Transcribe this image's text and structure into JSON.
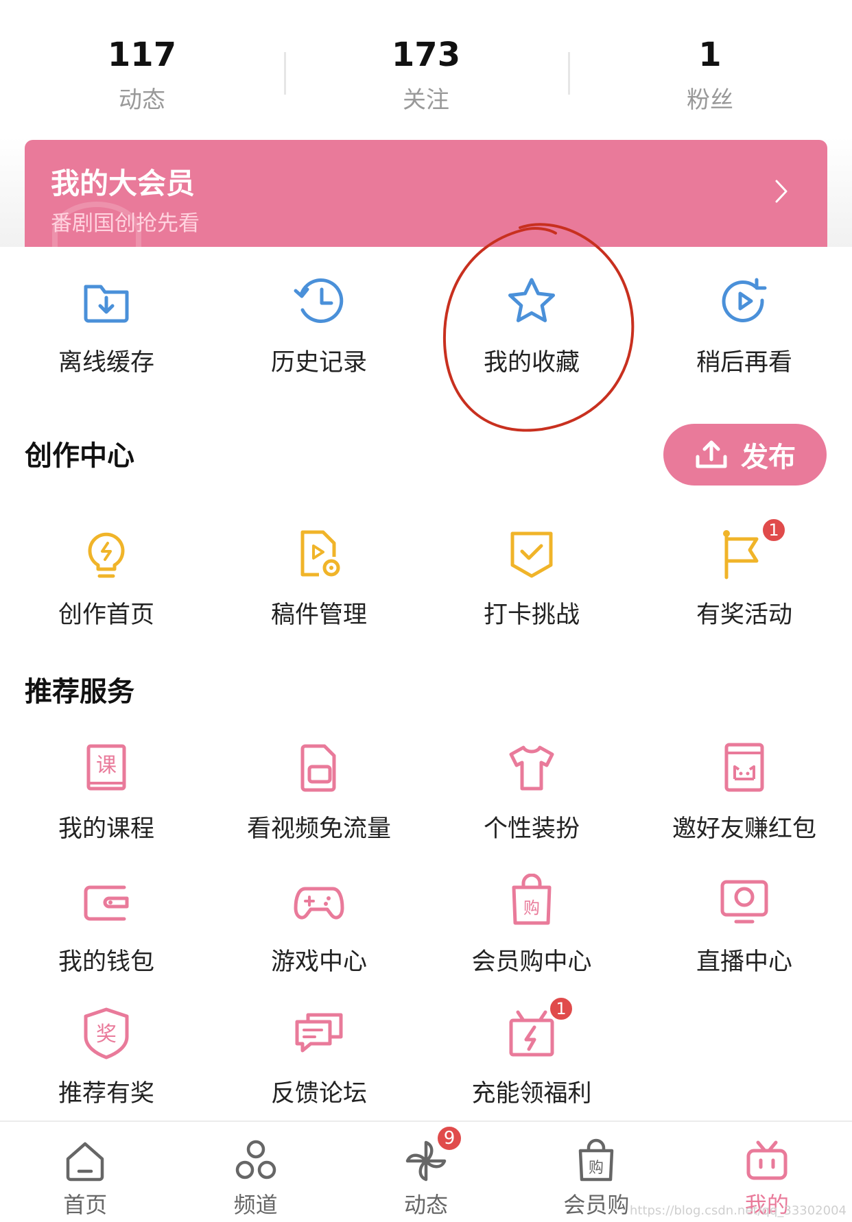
{
  "stats": [
    {
      "value": "117",
      "label": "动态"
    },
    {
      "value": "173",
      "label": "关注"
    },
    {
      "value": "1",
      "label": "粉丝"
    }
  ],
  "vip": {
    "title": "我的大会员",
    "subtitle": "番剧国创抢先看"
  },
  "quick": [
    {
      "label": "离线缓存",
      "icon": "download-folder-icon"
    },
    {
      "label": "历史记录",
      "icon": "history-clock-icon"
    },
    {
      "label": "我的收藏",
      "icon": "star-icon"
    },
    {
      "label": "稍后再看",
      "icon": "watch-later-icon"
    }
  ],
  "creation": {
    "title": "创作中心",
    "publish": "发布",
    "items": [
      {
        "label": "创作首页",
        "icon": "lightbulb-icon"
      },
      {
        "label": "稿件管理",
        "icon": "manuscript-icon"
      },
      {
        "label": "打卡挑战",
        "icon": "checkin-shield-icon"
      },
      {
        "label": "有奖活动",
        "icon": "flag-icon",
        "badge": "1"
      }
    ]
  },
  "services": {
    "title": "推荐服务",
    "rows": [
      [
        {
          "label": "我的课程",
          "icon": "course-book-icon"
        },
        {
          "label": "看视频免流量",
          "icon": "sim-card-icon"
        },
        {
          "label": "个性装扮",
          "icon": "tshirt-icon"
        },
        {
          "label": "邀好友赚红包",
          "icon": "red-envelope-icon"
        }
      ],
      [
        {
          "label": "我的钱包",
          "icon": "wallet-icon"
        },
        {
          "label": "游戏中心",
          "icon": "gamepad-icon"
        },
        {
          "label": "会员购中心",
          "icon": "shopping-bag-icon"
        },
        {
          "label": "直播中心",
          "icon": "live-tv-icon"
        }
      ],
      [
        {
          "label": "推荐有奖",
          "icon": "reward-badge-icon"
        },
        {
          "label": "反馈论坛",
          "icon": "chat-bubbles-icon"
        },
        {
          "label": "充能领福利",
          "icon": "gift-bolt-icon",
          "badge": "1"
        }
      ]
    ]
  },
  "tabs": [
    {
      "label": "首页",
      "icon": "home-icon"
    },
    {
      "label": "频道",
      "icon": "channel-icon"
    },
    {
      "label": "动态",
      "icon": "pinwheel-icon",
      "badge": "9"
    },
    {
      "label": "会员购",
      "icon": "shopping-bag-icon"
    },
    {
      "label": "我的",
      "icon": "tv-mascot-icon",
      "active": true
    }
  ],
  "watermark": "https://blog.csdn.net/qq_33302004",
  "colors": {
    "pink": "#e97a9a",
    "blue": "#4a90d9",
    "yellow": "#f0b429",
    "badge": "#e04b4b",
    "annotation": "#c8301f"
  }
}
